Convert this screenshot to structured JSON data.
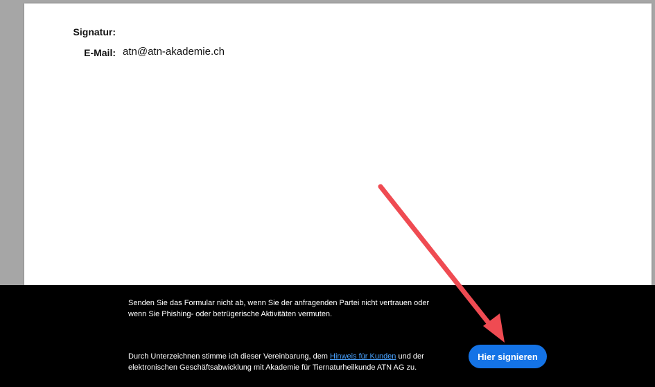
{
  "document": {
    "signature_label": "Signatur:",
    "email_label": "E-Mail:",
    "email_value": "atn@atn-akademie.ch"
  },
  "footer": {
    "notice": "Senden Sie das Formular nicht ab, wenn Sie der anfragenden Partei nicht vertrauen oder wenn Sie Phishing- oder betrügerische Aktivitäten vermuten.",
    "agreement_before": "Durch Unterzeichnen stimme ich dieser Vereinbarung, dem ",
    "agreement_link": "Hinweis für Kunden",
    "agreement_after": " und der elektronischen Geschäftsabwicklung mit Akademie für Tiernaturheilkunde ATN AG zu.",
    "sign_button": "Hier signieren"
  },
  "colors": {
    "button": "#1473e6",
    "link": "#4aa3ff",
    "annotation_arrow": "#ef4b52"
  }
}
